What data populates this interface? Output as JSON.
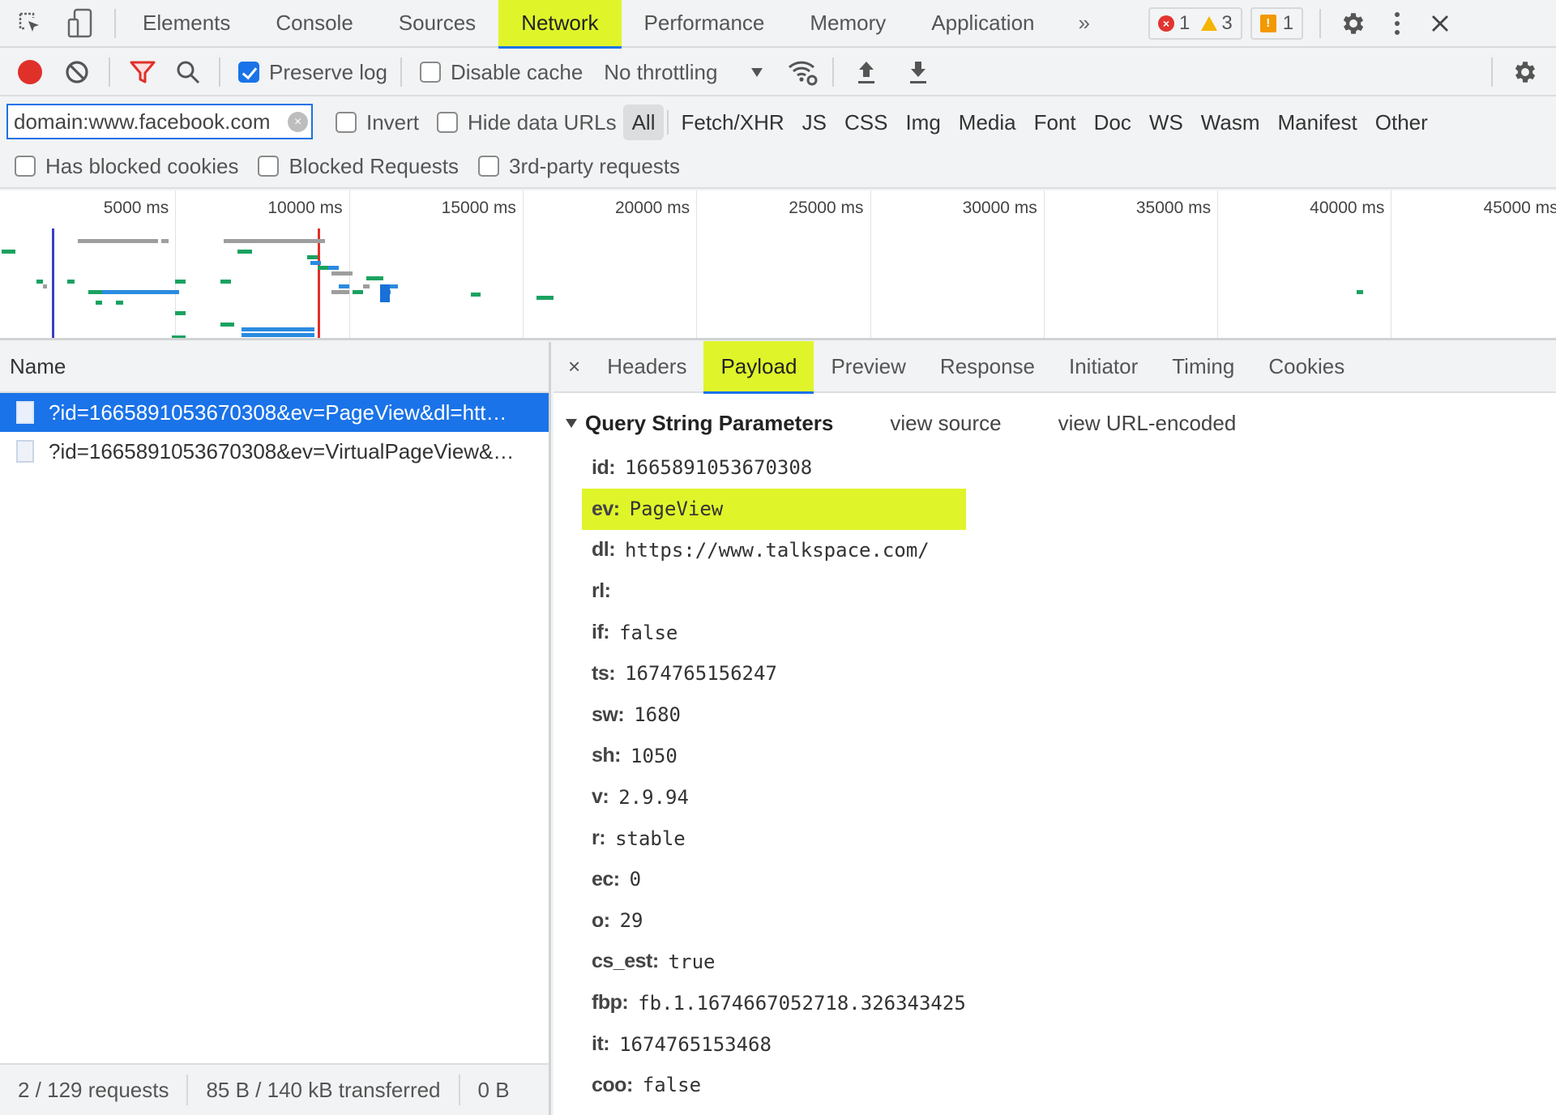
{
  "devtools": {
    "top_tabs": [
      {
        "label": "Elements",
        "active": false
      },
      {
        "label": "Console",
        "active": false
      },
      {
        "label": "Sources",
        "active": false
      },
      {
        "label": "Network",
        "active": true
      },
      {
        "label": "Performance",
        "active": false
      },
      {
        "label": "Memory",
        "active": false
      },
      {
        "label": "Application",
        "active": false
      }
    ],
    "more_tabs_glyph": "»",
    "counters": {
      "errors": "1",
      "warnings": "3",
      "issues": "1"
    },
    "icons": {
      "inspect": "inspect-element-icon",
      "device": "device-toolbar-icon",
      "settings": "gear-icon",
      "more": "kebab-menu-icon",
      "close": "close-icon"
    }
  },
  "network_toolbar": {
    "record": "record-icon",
    "clear": "clear-icon",
    "filter": "filter-icon",
    "search": "search-icon",
    "preserve_log": {
      "label": "Preserve log",
      "checked": true
    },
    "disable_cache": {
      "label": "Disable cache",
      "checked": false
    },
    "throttling": "No throttling",
    "network_conditions": "wifi-settings-icon",
    "import": "upload-har-icon",
    "export": "download-har-icon",
    "settings": "gear-icon"
  },
  "filter_bar": {
    "filter_value": "domain:www.facebook.com",
    "invert": {
      "label": "Invert",
      "checked": false
    },
    "hide_data_urls": {
      "label": "Hide data URLs",
      "checked": false
    },
    "types": [
      {
        "label": "All",
        "active": true
      },
      {
        "label": "Fetch/XHR",
        "active": false
      },
      {
        "label": "JS",
        "active": false
      },
      {
        "label": "CSS",
        "active": false
      },
      {
        "label": "Img",
        "active": false
      },
      {
        "label": "Media",
        "active": false
      },
      {
        "label": "Font",
        "active": false
      },
      {
        "label": "Doc",
        "active": false
      },
      {
        "label": "WS",
        "active": false
      },
      {
        "label": "Wasm",
        "active": false
      },
      {
        "label": "Manifest",
        "active": false
      },
      {
        "label": "Other",
        "active": false
      }
    ],
    "has_blocked_cookies": {
      "label": "Has blocked cookies",
      "checked": false
    },
    "blocked_requests": {
      "label": "Blocked Requests",
      "checked": false
    },
    "third_party": {
      "label": "3rd-party requests",
      "checked": false
    }
  },
  "overview": {
    "tick_labels": [
      "5000 ms",
      "10000 ms",
      "15000 ms",
      "20000 ms",
      "25000 ms",
      "30000 ms",
      "35000 ms",
      "40000 ms",
      "45000 ms"
    ],
    "dom_content_loaded_ms": 1450,
    "load_ms": 9100,
    "colors": {
      "dcl": "#3b3fc4",
      "load": "#e0302a",
      "waiting": "#1aa260",
      "download": "#2a8be0",
      "queued": "#9e9e9e"
    }
  },
  "requests": {
    "column_header": "Name",
    "rows": [
      {
        "name": "?id=1665891053670308&ev=PageView&dl=htt…",
        "selected": true
      },
      {
        "name": "?id=1665891053670308&ev=VirtualPageView&…",
        "selected": false
      }
    ],
    "status": {
      "requests": "2 / 129 requests",
      "transferred": "85 B / 140 kB transferred",
      "resources": "0 B"
    }
  },
  "detail": {
    "close_glyph": "×",
    "tabs": [
      {
        "label": "Headers",
        "active": false
      },
      {
        "label": "Payload",
        "active": true
      },
      {
        "label": "Preview",
        "active": false
      },
      {
        "label": "Response",
        "active": false
      },
      {
        "label": "Initiator",
        "active": false
      },
      {
        "label": "Timing",
        "active": false
      },
      {
        "label": "Cookies",
        "active": false
      }
    ],
    "section_title": "Query String Parameters",
    "view_source": "view source",
    "view_url_encoded": "view URL-encoded",
    "params": [
      {
        "key": "id:",
        "value": "1665891053670308",
        "highlight": false
      },
      {
        "key": "ev:",
        "value": "PageView",
        "highlight": true
      },
      {
        "key": "dl:",
        "value": "https://www.talkspace.com/",
        "highlight": false
      },
      {
        "key": "rl:",
        "value": "",
        "highlight": false
      },
      {
        "key": "if:",
        "value": "false",
        "highlight": false
      },
      {
        "key": "ts:",
        "value": "1674765156247",
        "highlight": false
      },
      {
        "key": "sw:",
        "value": "1680",
        "highlight": false
      },
      {
        "key": "sh:",
        "value": "1050",
        "highlight": false
      },
      {
        "key": "v:",
        "value": "2.9.94",
        "highlight": false
      },
      {
        "key": "r:",
        "value": "stable",
        "highlight": false
      },
      {
        "key": "ec:",
        "value": "0",
        "highlight": false
      },
      {
        "key": "o:",
        "value": "29",
        "highlight": false
      },
      {
        "key": "cs_est:",
        "value": "true",
        "highlight": false
      },
      {
        "key": "fbp:",
        "value": "fb.1.1674667052718.326343425",
        "highlight": false
      },
      {
        "key": "it:",
        "value": "1674765153468",
        "highlight": false
      },
      {
        "key": "coo:",
        "value": "false",
        "highlight": false
      }
    ]
  }
}
